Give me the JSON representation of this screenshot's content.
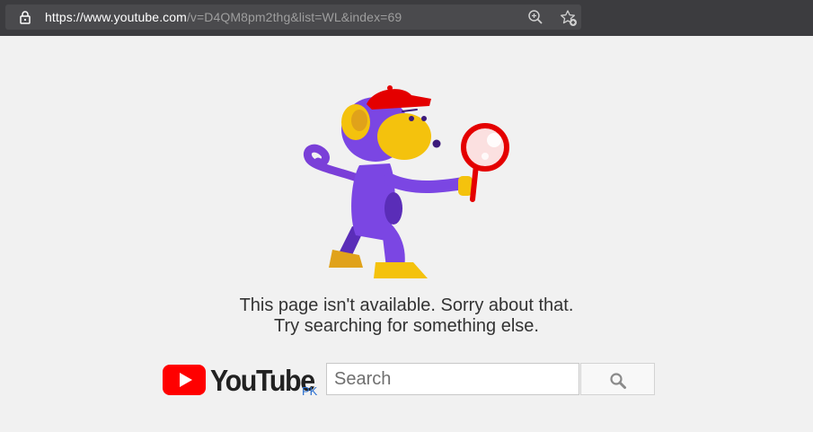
{
  "browser": {
    "url_scheme": "https://",
    "url_host": "www.youtube.com",
    "url_path": "/v=D4QM8pm2thg&list=WL&index=69",
    "icons": [
      "lock-icon",
      "zoom-icon",
      "favorite-icon"
    ]
  },
  "error": {
    "line1": "This page isn't available. Sorry about that.",
    "line2": "Try searching for something else."
  },
  "logo": {
    "wordmark": "YouTube",
    "region": "PK",
    "brand_color": "#ff0000"
  },
  "search": {
    "placeholder": "Search",
    "value": "",
    "button_icon": "search-icon"
  }
}
